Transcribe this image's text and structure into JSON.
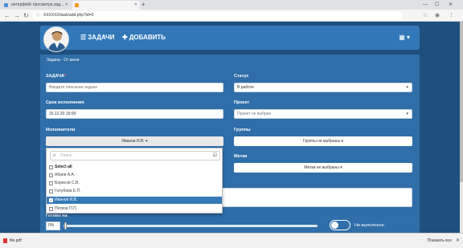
{
  "browser": {
    "tabs": [
      {
        "title": "интерфейс просмотра зад...",
        "favicon_color": "#4a90d9"
      },
      {
        "title": "",
        "favicon_color": "#f39c12"
      }
    ],
    "address": "XXXXXX/task/add.php?id=0",
    "new_tab": "+",
    "window_controls": {
      "minimize": "—",
      "maximize": "☐",
      "close": "✕"
    }
  },
  "nav": {
    "tasks_label": "ЗАДАЧИ",
    "add_label": "ДОБАВИТЬ",
    "grid_icon": "▦",
    "grid_caret": "▾"
  },
  "form": {
    "panel_title": "Задача - От меня",
    "task_label": "ЗАДАЧА",
    "task_placeholder": "Введите описание задачи",
    "status_label": "Статус",
    "status_value": "В работе",
    "deadline_label": "Срок исполнения",
    "deadline_value": "16.12.20 15:00",
    "project_label": "Проект",
    "project_value": "Проект не выбран",
    "executors_label": "Исполнители",
    "executors_button": "Иванов И.В.",
    "groups_label": "Группы",
    "groups_value": "Группы не выбраны",
    "tags_label": "Метки",
    "tags_value": "Метки не выбраны",
    "readiness_label": "Готово на",
    "readiness_value": "0%",
    "toggle_label": "Не выполнено"
  },
  "dropdown": {
    "search_placeholder": "Поиск",
    "items": [
      {
        "label": "Select all",
        "checked": false,
        "selected": false,
        "bold": true
      },
      {
        "label": "Абаев А.А.",
        "checked": false,
        "selected": false,
        "bold": false
      },
      {
        "label": "Борисов С.В.",
        "checked": false,
        "selected": false,
        "bold": false
      },
      {
        "label": "Голубева Е.П.",
        "checked": false,
        "selected": false,
        "bold": false
      },
      {
        "label": "Иванов И.В.",
        "checked": true,
        "selected": true,
        "bold": false
      },
      {
        "label": "Петров П.П.",
        "checked": false,
        "selected": false,
        "bold": false
      }
    ]
  },
  "download_bar": {
    "file_name": "file.pdf",
    "show_all": "Показать все",
    "close": "✕"
  },
  "colors": {
    "page_bg": "#1f4f7e",
    "nav_bg": "#3278b9",
    "panel_bg": "#2f6ea9",
    "selected_item": "#337ab7"
  }
}
